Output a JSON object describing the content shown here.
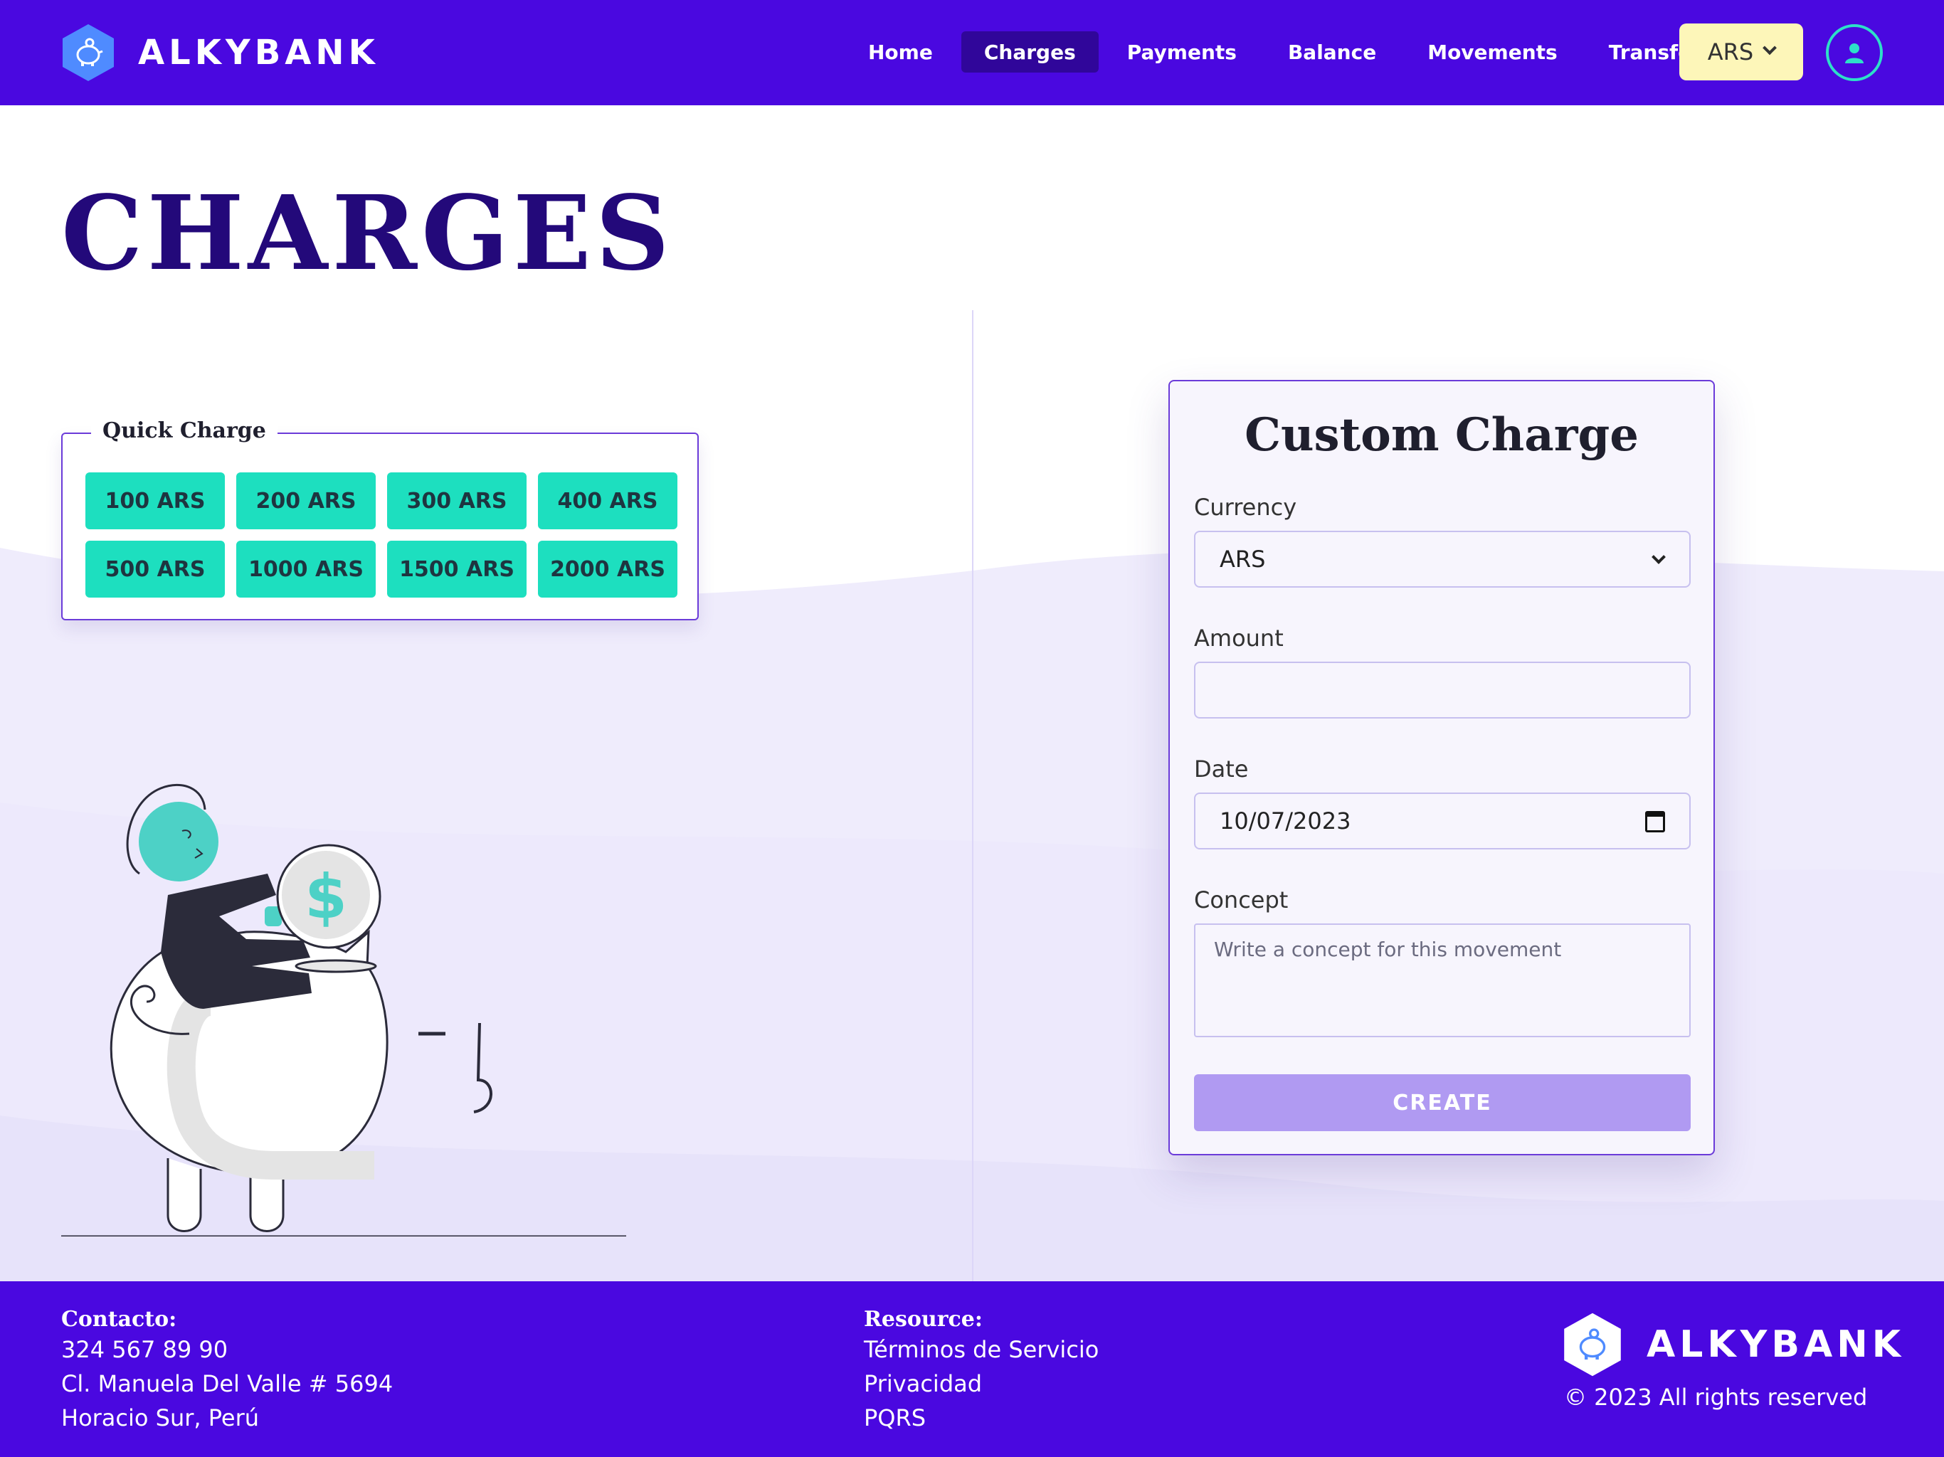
{
  "header": {
    "brand": "ALKYBANK",
    "nav": [
      {
        "label": "Home",
        "active": false
      },
      {
        "label": "Charges",
        "active": true
      },
      {
        "label": "Payments",
        "active": false
      },
      {
        "label": "Balance",
        "active": false
      },
      {
        "label": "Movements",
        "active": false
      },
      {
        "label": "Transfer",
        "active": false
      }
    ],
    "currency": "ARS",
    "user_icon": "user-icon"
  },
  "page": {
    "title": "CHARGES"
  },
  "quick_charge": {
    "legend": "Quick Charge",
    "buttons": [
      "100 ARS",
      "200 ARS",
      "300 ARS",
      "400 ARS",
      "500 ARS",
      "1000 ARS",
      "1500 ARS",
      "2000 ARS"
    ]
  },
  "custom_charge": {
    "title": "Custom Charge",
    "currency_label": "Currency",
    "currency_value": "ARS",
    "amount_label": "Amount",
    "amount_value": "",
    "date_label": "Date",
    "date_value": "10/07/2023",
    "concept_label": "Concept",
    "concept_placeholder": "Write a concept for this movement",
    "create_label": "CREATE"
  },
  "footer": {
    "contact_heading": "Contacto:",
    "contact_lines": [
      "324 567 89 90",
      "Cl. Manuela Del Valle # 5694",
      "Horacio Sur, Perú"
    ],
    "resource_heading": "Resource:",
    "resource_links": [
      "Términos de Servicio",
      "Privacidad",
      "PQRS"
    ],
    "brand": "ALKYBANK",
    "copyright": "© 2023 All rights reserved"
  },
  "colors": {
    "primary": "#4a08e0",
    "accent": "#1ddfbf",
    "title": "#23097a",
    "create_button": "#b09af2",
    "currency_button": "#fdf6b9"
  }
}
